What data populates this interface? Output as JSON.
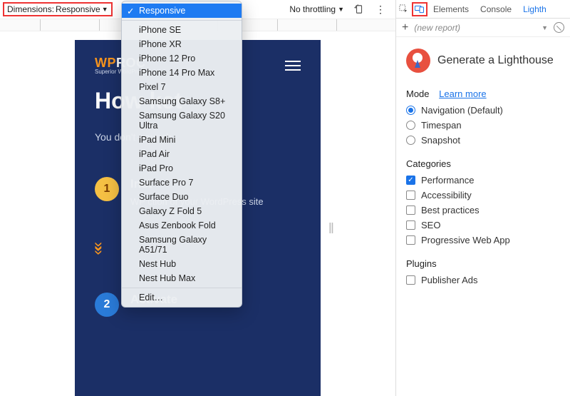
{
  "toolbar": {
    "dimensions_label": "Dimensions:",
    "dimensions_value": "Responsive",
    "throttling": "No throttling"
  },
  "device_menu": {
    "selected": "Responsive",
    "items": [
      "Responsive",
      "iPhone SE",
      "iPhone XR",
      "iPhone 12 Pro",
      "iPhone 14 Pro Max",
      "Pixel 7",
      "Samsung Galaxy S8+",
      "Samsung Galaxy S20 Ultra",
      "iPad Mini",
      "iPad Air",
      "iPad Pro",
      "Surface Pro 7",
      "Surface Duo",
      "Galaxy Z Fold 5",
      "Asus Zenbook Fold",
      "Samsung Galaxy A51/71",
      "Nest Hub",
      "Nest Hub Max"
    ],
    "edit": "Edit…"
  },
  "site": {
    "logo_a": "WP",
    "logo_b": "ROC",
    "logo_sub": "Superior WordPress",
    "hero": "How             ket",
    "sub": "You don't r                           aunch",
    "steps": [
      {
        "num": "1",
        "title": "Inst",
        "body": "WP                                 ction of your WordPress site"
      },
      {
        "num": "2",
        "title": "Activate",
        "body": ""
      }
    ]
  },
  "tabs": {
    "elements": "Elements",
    "console": "Console",
    "lighthouse": "Lighth"
  },
  "subbar": {
    "new_report": "(new report)"
  },
  "lighthouse": {
    "title": "Generate a Lighthouse",
    "mode_label": "Mode",
    "learn": "Learn more",
    "modes": [
      {
        "label": "Navigation (Default)",
        "on": true
      },
      {
        "label": "Timespan",
        "on": false
      },
      {
        "label": "Snapshot",
        "on": false
      }
    ],
    "cat_label": "Categories",
    "cats": [
      {
        "label": "Performance",
        "on": true
      },
      {
        "label": "Accessibility",
        "on": false
      },
      {
        "label": "Best practices",
        "on": false
      },
      {
        "label": "SEO",
        "on": false
      },
      {
        "label": "Progressive Web App",
        "on": false
      }
    ],
    "plugin_label": "Plugins",
    "plugins": [
      {
        "label": "Publisher Ads",
        "on": false
      }
    ]
  }
}
